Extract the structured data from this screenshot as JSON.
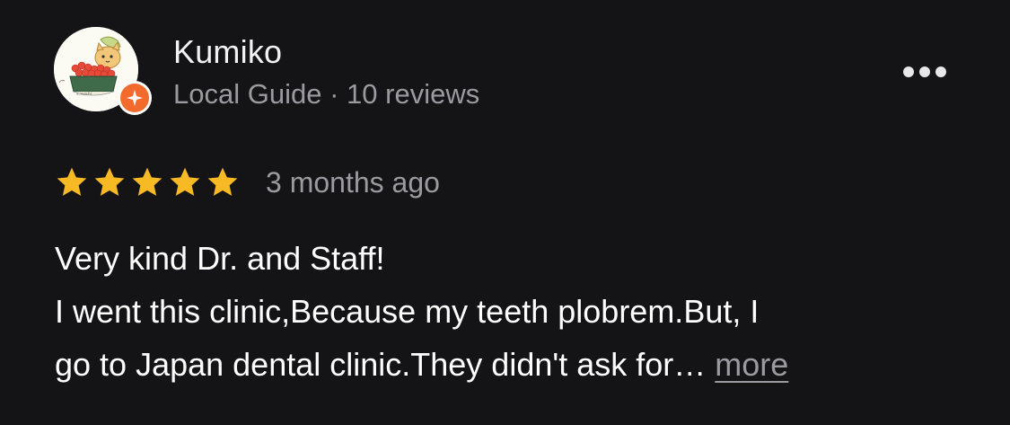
{
  "review": {
    "author": {
      "name": "Kumiko",
      "badge": "Local Guide",
      "separator": "·",
      "review_count": "10 reviews",
      "avatar_icon": "cat-in-sushi-bowl-avatar",
      "badge_icon": "local-guide-star-badge"
    },
    "menu_icon": "more-horizontal-icon",
    "rating": 5,
    "rating_max": 5,
    "date": "3 months ago",
    "text_lines": [
      "Very kind Dr. and Staff!",
      "I went this clinic,Because my teeth plobrem.But, I",
      "go to Japan dental clinic.They didn't ask for… "
    ],
    "more_label": "more"
  },
  "colors": {
    "background": "#141416",
    "primary_text": "#ffffff",
    "secondary_text": "#9a9aa0",
    "star": "#f7b924",
    "guide_badge": "#f26b2d"
  }
}
